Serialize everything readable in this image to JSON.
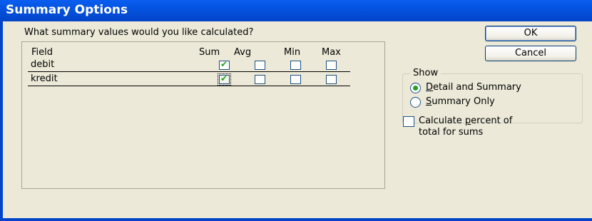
{
  "window": {
    "title": "Summary Options"
  },
  "prompt": "What summary values would you like calculated?",
  "buttons": {
    "ok": "OK",
    "cancel": "Cancel"
  },
  "table": {
    "headers": [
      "Field",
      "Sum",
      "Avg",
      "Min",
      "Max"
    ],
    "rows": [
      {
        "field": "debit",
        "sum": true,
        "avg": false,
        "min": false,
        "max": false
      },
      {
        "field": "kredit",
        "sum": true,
        "avg": false,
        "min": false,
        "max": false
      }
    ]
  },
  "show": {
    "label": "Show",
    "options": [
      {
        "prefix": "",
        "underline": "D",
        "rest": "etail and Summary",
        "selected": true
      },
      {
        "prefix": "",
        "underline": "S",
        "rest": "ummary Only",
        "selected": false
      }
    ]
  },
  "percent": {
    "line1_prefix": "Calculate ",
    "line1_underline": "p",
    "line1_rest": "ercent of",
    "line2": "total for sums",
    "checked": false
  },
  "colors": {
    "titlebar": "#0453e0",
    "check": "#21a121",
    "face": "#ece9d8"
  }
}
